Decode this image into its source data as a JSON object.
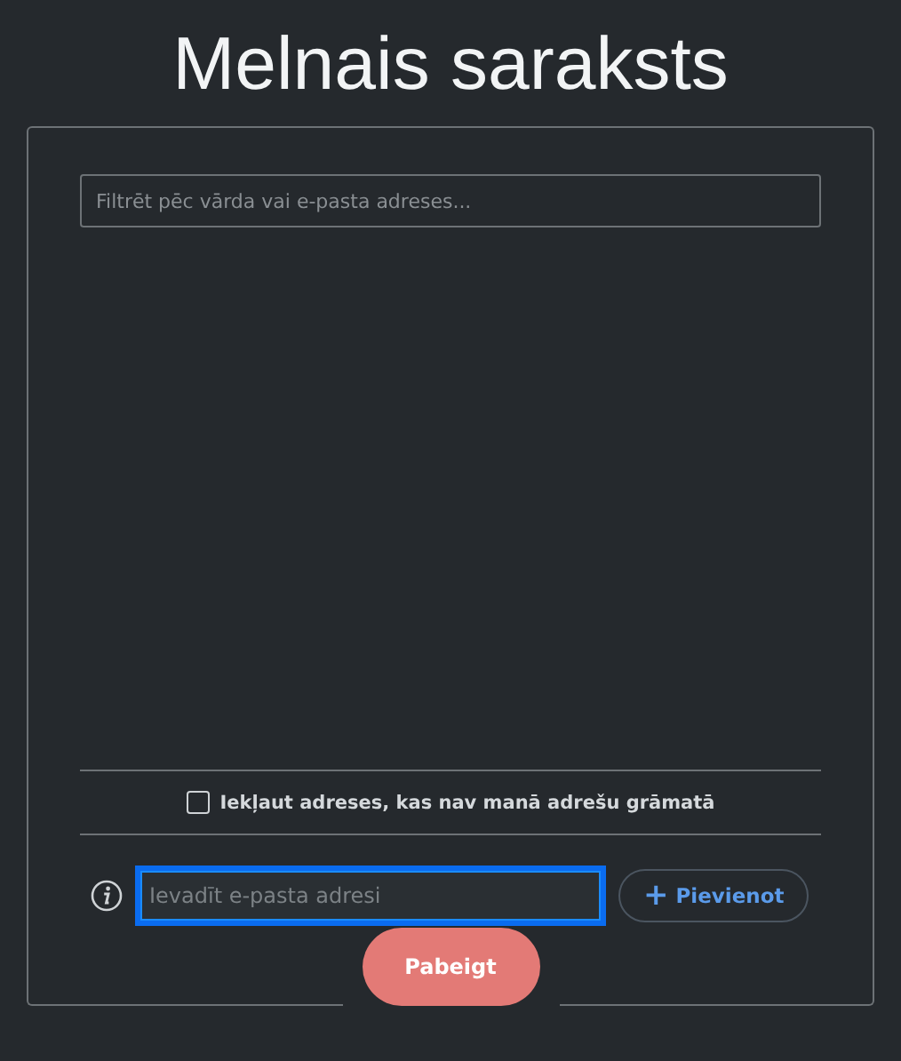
{
  "title": "Melnais saraksts",
  "filter": {
    "placeholder": "Filtrēt pēc vārda vai e-pasta adreses..."
  },
  "include_option": {
    "label": "Iekļaut adreses, kas nav manā adrešu grāmatā",
    "checked": false
  },
  "email_field": {
    "placeholder": "Ievadīt e-pasta adresi",
    "focused": true
  },
  "add_button": {
    "icon": "+",
    "label": "Pievienot"
  },
  "finish_button": {
    "label": "Pabeigt"
  }
}
